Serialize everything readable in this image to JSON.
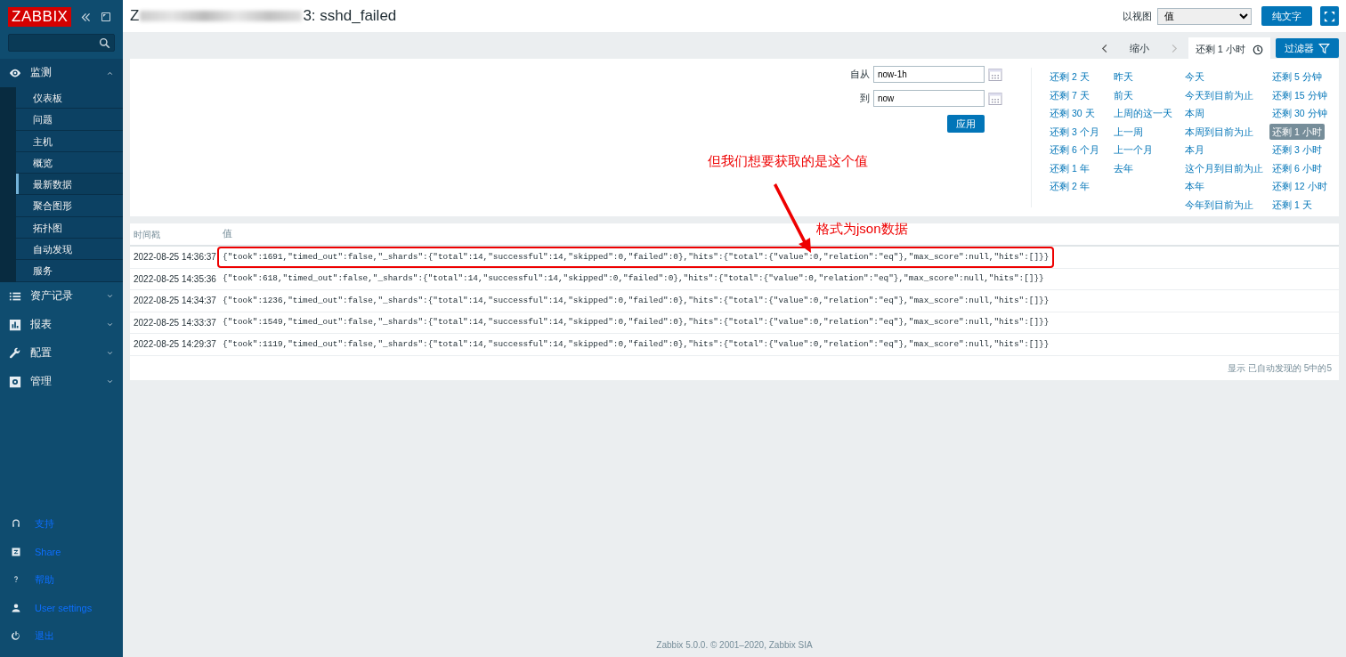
{
  "sidebar": {
    "logo": "ZABBIX",
    "menu": [
      {
        "label": "监测",
        "expanded": true,
        "children": [
          {
            "label": "仪表板",
            "selected": false
          },
          {
            "label": "问题",
            "selected": false
          },
          {
            "label": "主机",
            "selected": false
          },
          {
            "label": "概览",
            "selected": false
          },
          {
            "label": "最新数据",
            "selected": true
          },
          {
            "label": "聚合图形",
            "selected": false
          },
          {
            "label": "拓扑图",
            "selected": false
          },
          {
            "label": "自动发现",
            "selected": false
          },
          {
            "label": "服务",
            "selected": false
          }
        ]
      },
      {
        "label": "资产记录",
        "expanded": false
      },
      {
        "label": "报表",
        "expanded": false
      },
      {
        "label": "配置",
        "expanded": false
      },
      {
        "label": "管理",
        "expanded": false
      }
    ],
    "bottom": [
      {
        "label": "支持"
      },
      {
        "label": "Share"
      },
      {
        "label": "帮助"
      },
      {
        "label": "User settings"
      },
      {
        "label": "退出"
      }
    ]
  },
  "header": {
    "title_prefix": "Z",
    "title_suffix": "3: sshd_failed",
    "view_label": "以视图",
    "view_value": "值",
    "plain_text_button": "纯文字"
  },
  "filter_bar": {
    "zoom_out": "缩小",
    "time_tab": "还剩 1 小时",
    "filter_button": "过滤器"
  },
  "time_form": {
    "from_label": "自从",
    "from_value": "now-1h",
    "to_label": "到",
    "to_value": "now",
    "apply": "应用"
  },
  "quick_ranges": [
    [
      {
        "label": "还剩 2 天",
        "selected": false
      },
      {
        "label": "还剩 7 天",
        "selected": false
      },
      {
        "label": "还剩 30 天",
        "selected": false
      },
      {
        "label": "还剩 3 个月",
        "selected": false
      },
      {
        "label": "还剩 6 个月",
        "selected": false
      },
      {
        "label": "还剩 1 年",
        "selected": false
      },
      {
        "label": "还剩 2 年",
        "selected": false
      }
    ],
    [
      {
        "label": "昨天",
        "selected": false
      },
      {
        "label": "前天",
        "selected": false
      },
      {
        "label": "上周的这一天",
        "selected": false
      },
      {
        "label": "上一周",
        "selected": false
      },
      {
        "label": "上一个月",
        "selected": false
      },
      {
        "label": "去年",
        "selected": false
      }
    ],
    [
      {
        "label": "今天",
        "selected": false
      },
      {
        "label": "今天到目前为止",
        "selected": false
      },
      {
        "label": "本周",
        "selected": false
      },
      {
        "label": "本周到目前为止",
        "selected": false
      },
      {
        "label": "本月",
        "selected": false
      },
      {
        "label": "这个月到目前为止",
        "selected": false
      },
      {
        "label": "本年",
        "selected": false
      },
      {
        "label": "今年到目前为止",
        "selected": false
      }
    ],
    [
      {
        "label": "还剩 5 分钟",
        "selected": false
      },
      {
        "label": "还剩 15 分钟",
        "selected": false
      },
      {
        "label": "还剩 30 分钟",
        "selected": false
      },
      {
        "label": "还剩 1 小时",
        "selected": true
      },
      {
        "label": "还剩 3 小时",
        "selected": false
      },
      {
        "label": "还剩 6 小时",
        "selected": false
      },
      {
        "label": "还剩 12 小时",
        "selected": false
      },
      {
        "label": "还剩 1 天",
        "selected": false
      }
    ]
  ],
  "table": {
    "columns": [
      "时间戳",
      "值"
    ],
    "rows": [
      {
        "timestamp": "2022-08-25 14:36:37",
        "value": "{\"took\":1691,\"timed_out\":false,\"_shards\":{\"total\":14,\"successful\":14,\"skipped\":0,\"failed\":0},\"hits\":{\"total\":{\"value\":0,\"relation\":\"eq\"},\"max_score\":null,\"hits\":[]}}",
        "highlighted": true
      },
      {
        "timestamp": "2022-08-25 14:35:36",
        "value": "{\"took\":618,\"timed_out\":false,\"_shards\":{\"total\":14,\"successful\":14,\"skipped\":0,\"failed\":0},\"hits\":{\"total\":{\"value\":0,\"relation\":\"eq\"},\"max_score\":null,\"hits\":[]}}",
        "highlighted": false
      },
      {
        "timestamp": "2022-08-25 14:34:37",
        "value": "{\"took\":1236,\"timed_out\":false,\"_shards\":{\"total\":14,\"successful\":14,\"skipped\":0,\"failed\":0},\"hits\":{\"total\":{\"value\":0,\"relation\":\"eq\"},\"max_score\":null,\"hits\":[]}}",
        "highlighted": false
      },
      {
        "timestamp": "2022-08-25 14:33:37",
        "value": "{\"took\":1549,\"timed_out\":false,\"_shards\":{\"total\":14,\"successful\":14,\"skipped\":0,\"failed\":0},\"hits\":{\"total\":{\"value\":0,\"relation\":\"eq\"},\"max_score\":null,\"hits\":[]}}",
        "highlighted": false
      },
      {
        "timestamp": "2022-08-25 14:29:37",
        "value": "{\"took\":1119,\"timed_out\":false,\"_shards\":{\"total\":14,\"successful\":14,\"skipped\":0,\"failed\":0},\"hits\":{\"total\":{\"value\":0,\"relation\":\"eq\"},\"max_score\":null,\"hits\":[]}}",
        "highlighted": false
      }
    ],
    "summary": "显示 已自动发现的 5中的5"
  },
  "annotations": [
    {
      "kind": "note",
      "text": "但我们想要获取的是这个值"
    },
    {
      "kind": "note",
      "text": "格式为json数据"
    },
    {
      "kind": "arrow"
    }
  ],
  "footer": {
    "text": "Zabbix 5.0.0. © 2001–2020, ",
    "link": "Zabbix SIA"
  }
}
